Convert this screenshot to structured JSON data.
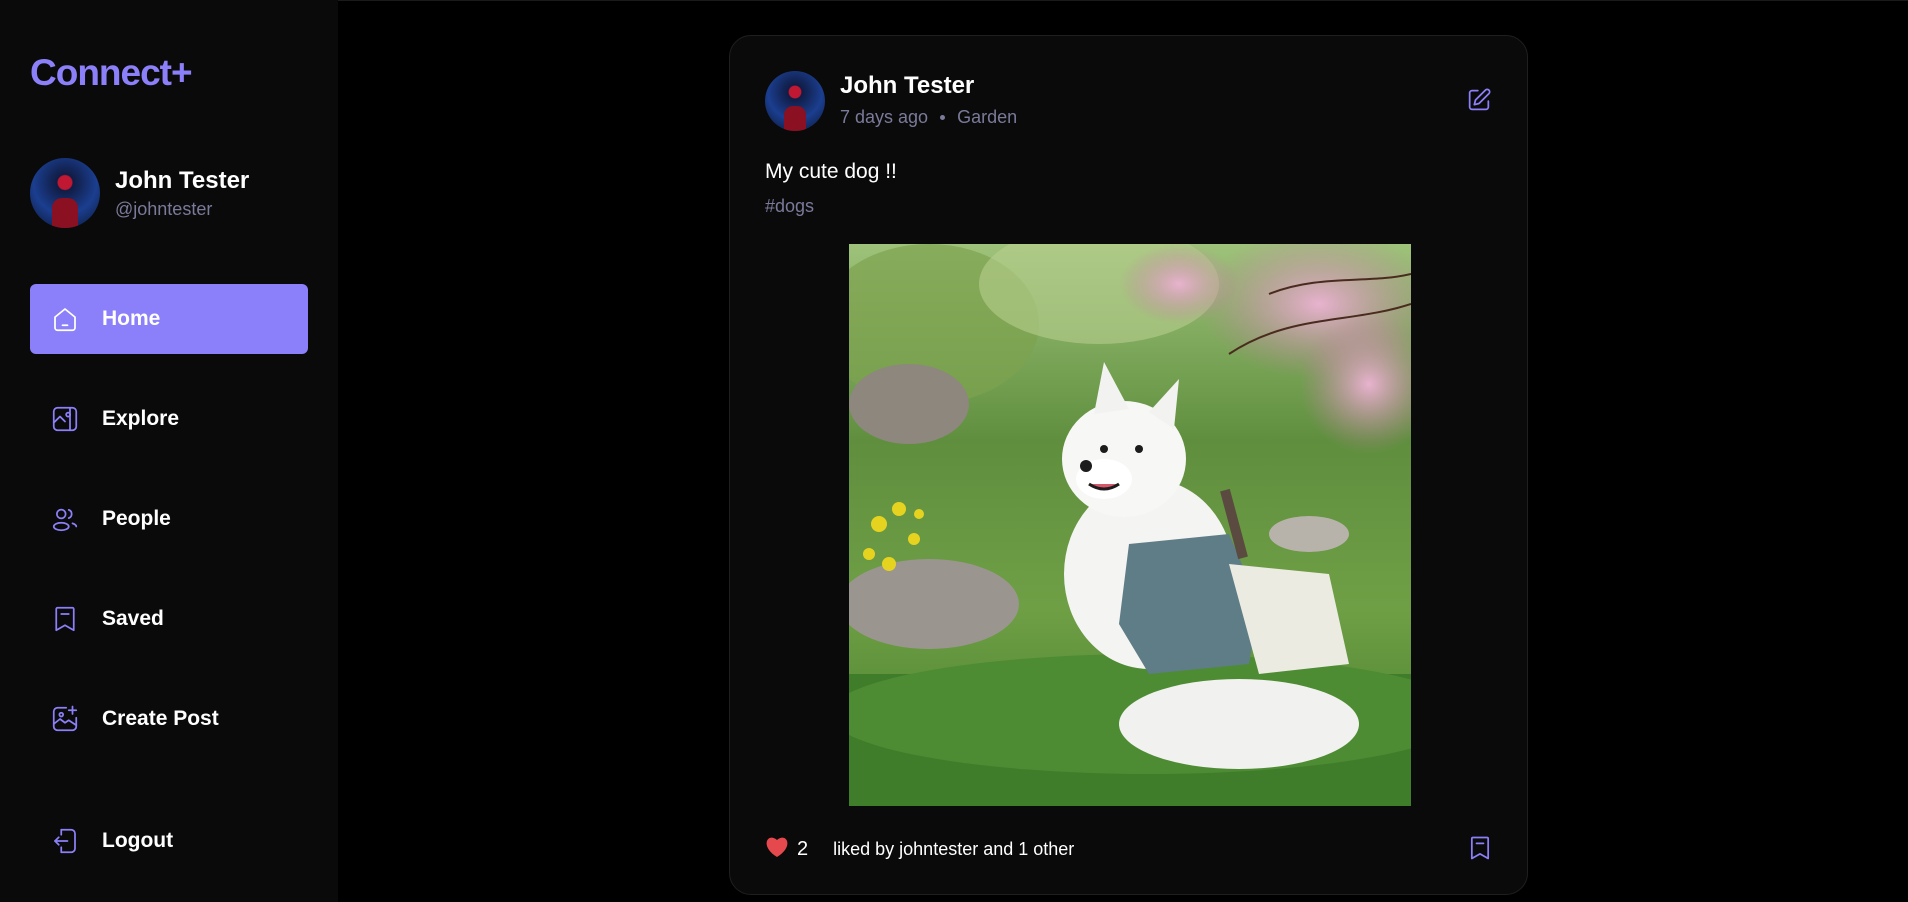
{
  "app": {
    "logo": "Connect+",
    "accent_color": "#8b80f9"
  },
  "sidebar": {
    "user": {
      "name": "John Tester",
      "handle": "@johntester"
    },
    "nav": [
      {
        "label": "Home",
        "icon": "home-icon",
        "active": true
      },
      {
        "label": "Explore",
        "icon": "explore-icon",
        "active": false
      },
      {
        "label": "People",
        "icon": "people-icon",
        "active": false
      },
      {
        "label": "Saved",
        "icon": "bookmark-icon",
        "active": false
      },
      {
        "label": "Create Post",
        "icon": "create-post-icon",
        "active": false
      }
    ],
    "logout_label": "Logout"
  },
  "post": {
    "author": "John Tester",
    "time": "7 days ago",
    "location": "Garden",
    "caption": "My cute dog !!",
    "tags": "#dogs",
    "likes": "2",
    "liked_by": "liked by johntester and 1 other"
  }
}
